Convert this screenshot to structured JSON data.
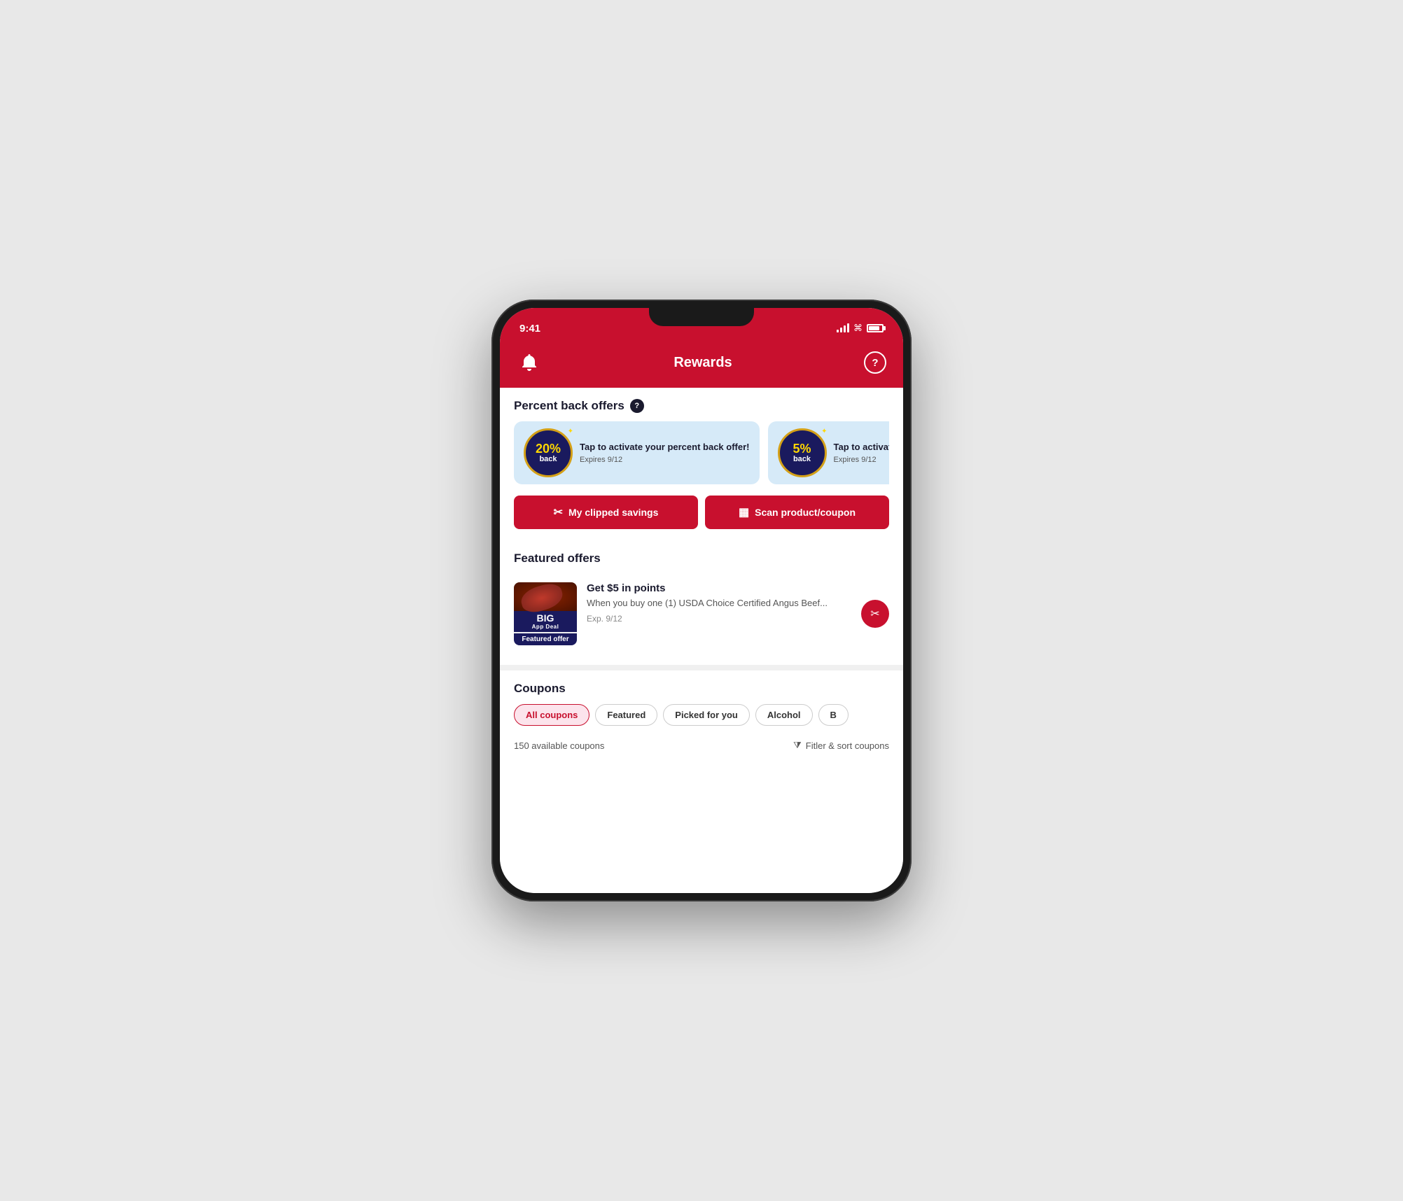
{
  "phone": {
    "status_bar": {
      "time": "9:41",
      "signal_bars": [
        4,
        7,
        10,
        13
      ],
      "wifi": "wifi",
      "battery_pct": 85
    },
    "header": {
      "title": "Rewards",
      "notification_icon": "bell",
      "help_icon": "?"
    },
    "percent_back": {
      "section_title": "Percent back offers",
      "offers": [
        {
          "percent": "20%",
          "back_label": "back",
          "activate_text": "Tap to activate your percent back offer!",
          "expires": "Expires 9/12"
        },
        {
          "percent": "5%",
          "back_label": "back",
          "activate_text": "Tap to activate your percent back offer!",
          "expires": "Expires 9/12"
        }
      ]
    },
    "action_buttons": [
      {
        "id": "clipped-savings",
        "icon": "✂",
        "label": "My clipped savings"
      },
      {
        "id": "scan-coupon",
        "icon": "▦",
        "label": "Scan product/coupon"
      }
    ],
    "featured_offers": {
      "section_title": "Featured offers",
      "items": [
        {
          "big_label": "BIG",
          "app_deal_label": "App Deal",
          "badge_label": "Featured offer",
          "title": "Get $5 in points",
          "description": "When you buy one (1) USDA Choice Certified Angus Beef...",
          "expires": "Exp. 9/12"
        }
      ]
    },
    "coupons": {
      "section_title": "Coupons",
      "tabs": [
        {
          "id": "all",
          "label": "All coupons",
          "active": true
        },
        {
          "id": "featured",
          "label": "Featured",
          "active": false
        },
        {
          "id": "picked",
          "label": "Picked for you",
          "active": false
        },
        {
          "id": "alcohol",
          "label": "Alcohol",
          "active": false
        },
        {
          "id": "more",
          "label": "B...",
          "active": false
        }
      ],
      "available_count": "150 available coupons",
      "filter_sort_label": "Fitler & sort coupons"
    }
  }
}
